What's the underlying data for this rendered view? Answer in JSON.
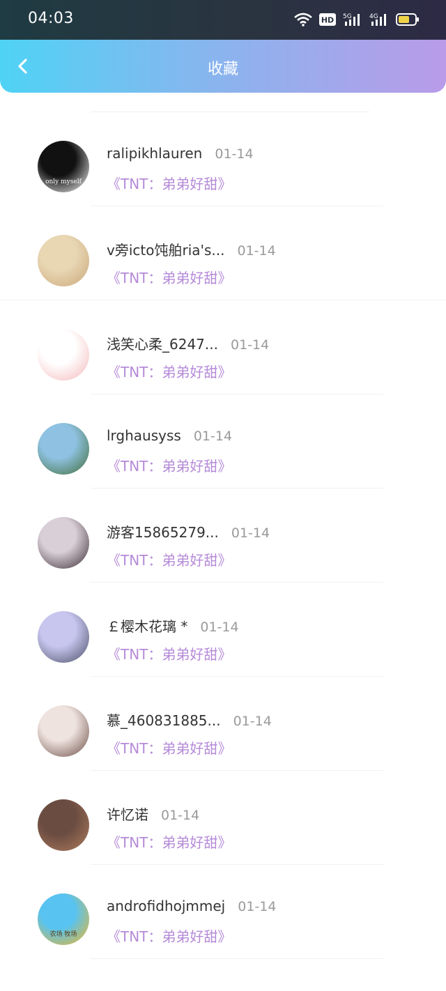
{
  "status_bar": {
    "time": "04:03",
    "icons": [
      "wifi-icon",
      "hd-icon",
      "5g-signal-icon",
      "4g-signal-icon",
      "battery-icon"
    ],
    "hd_label": "HD",
    "net1": "5G",
    "net2": "4G",
    "battery_color": "#f0d24a"
  },
  "nav": {
    "title": "收藏",
    "back_icon": "chevron-left-icon",
    "gradient": [
      "#4fd3f5",
      "#86b6ee",
      "#b99be9"
    ]
  },
  "items": [
    {
      "name": "ralipikhlauren",
      "date": "01-14",
      "book": "《TNT：弟弟好甜》",
      "avatar_colors": [
        "#111111",
        "#ffffff"
      ],
      "avatar_text": "only myself"
    },
    {
      "name": "v旁icto饨舶ria's...",
      "date": "01-14",
      "book": "《TNT：弟弟好甜》",
      "avatar_colors": [
        "#e9d7b4",
        "#c9a77a"
      ]
    },
    {
      "name": "浅笑心柔_6247...",
      "date": "01-14",
      "book": "《TNT：弟弟好甜》",
      "avatar_colors": [
        "#ffffff",
        "#f4b7ba"
      ]
    },
    {
      "name": "lrghausyss",
      "date": "01-14",
      "book": "《TNT：弟弟好甜》",
      "avatar_colors": [
        "#8fc2e2",
        "#3e6b34"
      ]
    },
    {
      "name": "游客15865279...",
      "date": "01-14",
      "book": "《TNT：弟弟好甜》",
      "avatar_colors": [
        "#d9cfd6",
        "#3a2b35"
      ]
    },
    {
      "name": "￡樱木花璃 *",
      "date": "01-14",
      "book": "《TNT：弟弟好甜》",
      "avatar_colors": [
        "#c8c6ef",
        "#4a4e66"
      ]
    },
    {
      "name": "慕_460831885...",
      "date": "01-14",
      "book": "《TNT：弟弟好甜》",
      "avatar_colors": [
        "#efe3df",
        "#6a4c43"
      ]
    },
    {
      "name": "许忆诺",
      "date": "01-14",
      "book": "《TNT：弟弟好甜》",
      "avatar_colors": [
        "#6a4c41",
        "#b07c5e"
      ]
    },
    {
      "name": "androfidhojmmej",
      "date": "01-14",
      "book": "《TNT：弟弟好甜》",
      "avatar_colors": [
        "#58c3f0",
        "#f2b625"
      ],
      "avatar_text": "农场 牧场"
    }
  ]
}
